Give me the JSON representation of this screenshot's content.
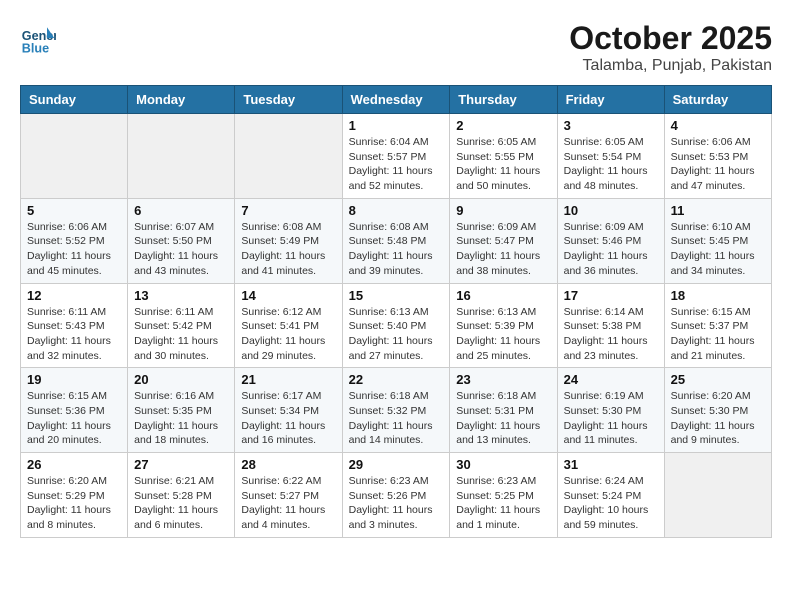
{
  "header": {
    "logo_line1": "General",
    "logo_line2": "Blue",
    "month": "October 2025",
    "location": "Talamba, Punjab, Pakistan"
  },
  "weekdays": [
    "Sunday",
    "Monday",
    "Tuesday",
    "Wednesday",
    "Thursday",
    "Friday",
    "Saturday"
  ],
  "weeks": [
    [
      {
        "day": "",
        "info": ""
      },
      {
        "day": "",
        "info": ""
      },
      {
        "day": "",
        "info": ""
      },
      {
        "day": "1",
        "info": "Sunrise: 6:04 AM\nSunset: 5:57 PM\nDaylight: 11 hours\nand 52 minutes."
      },
      {
        "day": "2",
        "info": "Sunrise: 6:05 AM\nSunset: 5:55 PM\nDaylight: 11 hours\nand 50 minutes."
      },
      {
        "day": "3",
        "info": "Sunrise: 6:05 AM\nSunset: 5:54 PM\nDaylight: 11 hours\nand 48 minutes."
      },
      {
        "day": "4",
        "info": "Sunrise: 6:06 AM\nSunset: 5:53 PM\nDaylight: 11 hours\nand 47 minutes."
      }
    ],
    [
      {
        "day": "5",
        "info": "Sunrise: 6:06 AM\nSunset: 5:52 PM\nDaylight: 11 hours\nand 45 minutes."
      },
      {
        "day": "6",
        "info": "Sunrise: 6:07 AM\nSunset: 5:50 PM\nDaylight: 11 hours\nand 43 minutes."
      },
      {
        "day": "7",
        "info": "Sunrise: 6:08 AM\nSunset: 5:49 PM\nDaylight: 11 hours\nand 41 minutes."
      },
      {
        "day": "8",
        "info": "Sunrise: 6:08 AM\nSunset: 5:48 PM\nDaylight: 11 hours\nand 39 minutes."
      },
      {
        "day": "9",
        "info": "Sunrise: 6:09 AM\nSunset: 5:47 PM\nDaylight: 11 hours\nand 38 minutes."
      },
      {
        "day": "10",
        "info": "Sunrise: 6:09 AM\nSunset: 5:46 PM\nDaylight: 11 hours\nand 36 minutes."
      },
      {
        "day": "11",
        "info": "Sunrise: 6:10 AM\nSunset: 5:45 PM\nDaylight: 11 hours\nand 34 minutes."
      }
    ],
    [
      {
        "day": "12",
        "info": "Sunrise: 6:11 AM\nSunset: 5:43 PM\nDaylight: 11 hours\nand 32 minutes."
      },
      {
        "day": "13",
        "info": "Sunrise: 6:11 AM\nSunset: 5:42 PM\nDaylight: 11 hours\nand 30 minutes."
      },
      {
        "day": "14",
        "info": "Sunrise: 6:12 AM\nSunset: 5:41 PM\nDaylight: 11 hours\nand 29 minutes."
      },
      {
        "day": "15",
        "info": "Sunrise: 6:13 AM\nSunset: 5:40 PM\nDaylight: 11 hours\nand 27 minutes."
      },
      {
        "day": "16",
        "info": "Sunrise: 6:13 AM\nSunset: 5:39 PM\nDaylight: 11 hours\nand 25 minutes."
      },
      {
        "day": "17",
        "info": "Sunrise: 6:14 AM\nSunset: 5:38 PM\nDaylight: 11 hours\nand 23 minutes."
      },
      {
        "day": "18",
        "info": "Sunrise: 6:15 AM\nSunset: 5:37 PM\nDaylight: 11 hours\nand 21 minutes."
      }
    ],
    [
      {
        "day": "19",
        "info": "Sunrise: 6:15 AM\nSunset: 5:36 PM\nDaylight: 11 hours\nand 20 minutes."
      },
      {
        "day": "20",
        "info": "Sunrise: 6:16 AM\nSunset: 5:35 PM\nDaylight: 11 hours\nand 18 minutes."
      },
      {
        "day": "21",
        "info": "Sunrise: 6:17 AM\nSunset: 5:34 PM\nDaylight: 11 hours\nand 16 minutes."
      },
      {
        "day": "22",
        "info": "Sunrise: 6:18 AM\nSunset: 5:32 PM\nDaylight: 11 hours\nand 14 minutes."
      },
      {
        "day": "23",
        "info": "Sunrise: 6:18 AM\nSunset: 5:31 PM\nDaylight: 11 hours\nand 13 minutes."
      },
      {
        "day": "24",
        "info": "Sunrise: 6:19 AM\nSunset: 5:30 PM\nDaylight: 11 hours\nand 11 minutes."
      },
      {
        "day": "25",
        "info": "Sunrise: 6:20 AM\nSunset: 5:30 PM\nDaylight: 11 hours\nand 9 minutes."
      }
    ],
    [
      {
        "day": "26",
        "info": "Sunrise: 6:20 AM\nSunset: 5:29 PM\nDaylight: 11 hours\nand 8 minutes."
      },
      {
        "day": "27",
        "info": "Sunrise: 6:21 AM\nSunset: 5:28 PM\nDaylight: 11 hours\nand 6 minutes."
      },
      {
        "day": "28",
        "info": "Sunrise: 6:22 AM\nSunset: 5:27 PM\nDaylight: 11 hours\nand 4 minutes."
      },
      {
        "day": "29",
        "info": "Sunrise: 6:23 AM\nSunset: 5:26 PM\nDaylight: 11 hours\nand 3 minutes."
      },
      {
        "day": "30",
        "info": "Sunrise: 6:23 AM\nSunset: 5:25 PM\nDaylight: 11 hours\nand 1 minute."
      },
      {
        "day": "31",
        "info": "Sunrise: 6:24 AM\nSunset: 5:24 PM\nDaylight: 10 hours\nand 59 minutes."
      },
      {
        "day": "",
        "info": ""
      }
    ]
  ]
}
